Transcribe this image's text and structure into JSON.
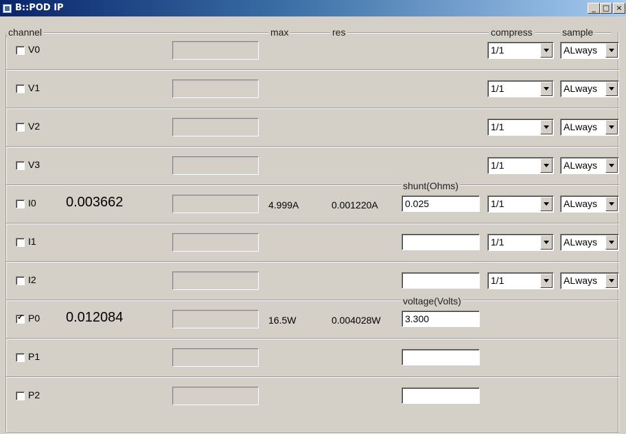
{
  "window": {
    "title": "B::POD IP",
    "minimize": "_",
    "maximize": "□",
    "close": "×"
  },
  "headers": {
    "channel": "channel",
    "max": "max",
    "res": "res",
    "compress": "compress",
    "sample": "sample"
  },
  "rows": [
    {
      "name": "V0",
      "checked": false,
      "value": "",
      "max": "",
      "res": "",
      "sub_label": "",
      "sub_value": "",
      "show_text": false,
      "compress": "1/1",
      "sample": "ALways"
    },
    {
      "name": "V1",
      "checked": false,
      "value": "",
      "max": "",
      "res": "",
      "sub_label": "",
      "sub_value": "",
      "show_text": false,
      "compress": "1/1",
      "sample": "ALways"
    },
    {
      "name": "V2",
      "checked": false,
      "value": "",
      "max": "",
      "res": "",
      "sub_label": "",
      "sub_value": "",
      "show_text": false,
      "compress": "1/1",
      "sample": "ALways"
    },
    {
      "name": "V3",
      "checked": false,
      "value": "",
      "max": "",
      "res": "",
      "sub_label": "",
      "sub_value": "",
      "show_text": false,
      "compress": "1/1",
      "sample": "ALways"
    },
    {
      "name": "I0",
      "checked": false,
      "value": "0.003662",
      "max": "4.999A",
      "res": "0.001220A",
      "sub_label": "shunt(Ohms)",
      "sub_value": "0.025",
      "show_text": true,
      "compress": "1/1",
      "sample": "ALways"
    },
    {
      "name": "I1",
      "checked": false,
      "value": "",
      "max": "",
      "res": "",
      "sub_label": "",
      "sub_value": "",
      "show_text": true,
      "compress": "1/1",
      "sample": "ALways"
    },
    {
      "name": "I2",
      "checked": false,
      "value": "",
      "max": "",
      "res": "",
      "sub_label": "",
      "sub_value": "",
      "show_text": true,
      "compress": "1/1",
      "sample": "ALways"
    },
    {
      "name": "P0",
      "checked": true,
      "value": "0.012084",
      "max": "16.5W",
      "res": "0.004028W",
      "sub_label": "voltage(Volts)",
      "sub_value": "3.300",
      "show_text": true,
      "compress": "",
      "sample": ""
    },
    {
      "name": "P1",
      "checked": false,
      "value": "",
      "max": "",
      "res": "",
      "sub_label": "",
      "sub_value": "",
      "show_text": true,
      "compress": "",
      "sample": ""
    },
    {
      "name": "P2",
      "checked": false,
      "value": "",
      "max": "",
      "res": "",
      "sub_label": "",
      "sub_value": "",
      "show_text": true,
      "compress": "",
      "sample": ""
    }
  ]
}
